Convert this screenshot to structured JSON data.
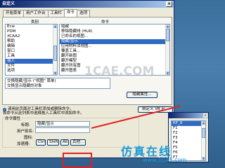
{
  "dialog": {
    "title": "自定义",
    "close": "×",
    "tabs": [
      {
        "label": "开始菜单"
      },
      {
        "label": "用户工作台"
      },
      {
        "label": "工具栏"
      },
      {
        "label": "命令"
      },
      {
        "label": "选项"
      }
    ],
    "categories_label": "类别",
    "commands_label": "命令",
    "categories": [
      "Ecw",
      "PDM",
      "XCAA2",
      "帮助",
      "编辑",
      "窗口",
      "工具",
      "插入",
      "文件",
      "选项"
    ],
    "categories_selected_index": 7,
    "commands": [
      "隐藏",
      "移除隐藏线 (HLR)",
      "已命名的视图...",
      "隐藏/显示",
      "应用材料法视图...",
      "覆盖工具...",
      "翻开新图",
      "翻开模型",
      "翻开所有图",
      "翻开图表"
    ],
    "commands_selected_index": 3,
    "description": "交换隐藏/显示 (\"视图\" 菜单)\n交换显示隐藏的对象",
    "btn_show_properties": "隐藏属性...",
    "info_text": "请用此页面对工具栏添加或删除命令。\n将命令从此列表中选择拖入工具栏中添加命令。",
    "cmd_props_legend": "命令属性",
    "title_label": "标题:",
    "title_value": "隐藏/显示",
    "user_alias_label": "用户别名:",
    "user_alias_value": "",
    "icon_label": "图标:",
    "accelerator_label": "加速器:",
    "key_buttons": [
      "Ctrl",
      "Shift",
      "Alt"
    ],
    "other_button": "其他...",
    "custom_button": "自定义 VB 宏..."
  },
  "side_window": {
    "items": [
      "KP_9",
      "F1",
      "F2",
      "F3",
      "F4",
      "F5",
      "F6",
      "F7",
      "F8",
      "F9"
    ],
    "selected_index": 0
  },
  "watermark": {
    "main": "仿真在线",
    "sub": "www.1CAE.com",
    "center": "1CAE.COM"
  },
  "colors": {
    "accent": "#316ac5",
    "highlight": "#e02020",
    "watermark": "#1a9ad6"
  }
}
